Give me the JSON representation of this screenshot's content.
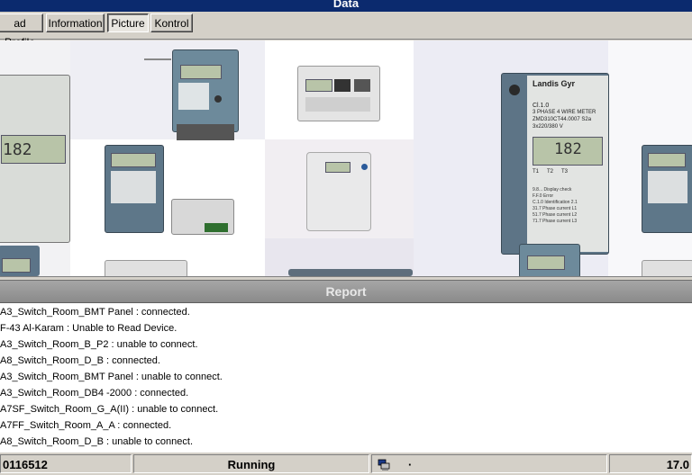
{
  "window": {
    "title": "Data"
  },
  "tabs": [
    {
      "label": "ad Profile",
      "active": false
    },
    {
      "label": "Information",
      "active": false
    },
    {
      "label": "Picture",
      "active": true
    },
    {
      "label": "Kontrol",
      "active": false
    }
  ],
  "meter_face": {
    "brand": "Landis Gyr",
    "class": "Cl.1.0",
    "phase_text": "3 PHASE 4 WIRE METER",
    "model": "ZMD310CT44.0007 S2a",
    "voltage": "3x220/380 V",
    "display": "182",
    "tariffs": [
      "T1",
      "T2",
      "T3"
    ],
    "codes": [
      "9.8... Display check",
      "F.F.0 Error",
      "C.1.0 Identification 2.1",
      "31.7 Phase current L1",
      "51.7 Phase current L2",
      "71.7 Phase current L3"
    ]
  },
  "report": {
    "title": "Report",
    "lines": [
      "A3_Switch_Room_BMT Panel : connected.",
      "F-43 Al-Karam : Unable to Read Device.",
      "A3_Switch_Room_B_P2 : unable to connect.",
      "A8_Switch_Room_D_B : connected.",
      "A3_Switch_Room_BMT Panel : unable to connect.",
      "A3_Switch_Room_DB4 -2000 : connected.",
      "A7SF_Switch_Room_G_A(II) : unable to connect.",
      "A7FF_Switch_Room_A_A : connected.",
      "A8_Switch_Room_D_B : unable to connect."
    ]
  },
  "status": {
    "id": "0116512",
    "state": "Running",
    "icon": "network-computer-icon",
    "dot": "·",
    "right": "17.0"
  },
  "colors": {
    "title_bg": "#0b2a6e",
    "report_header_bg": "#999999"
  }
}
